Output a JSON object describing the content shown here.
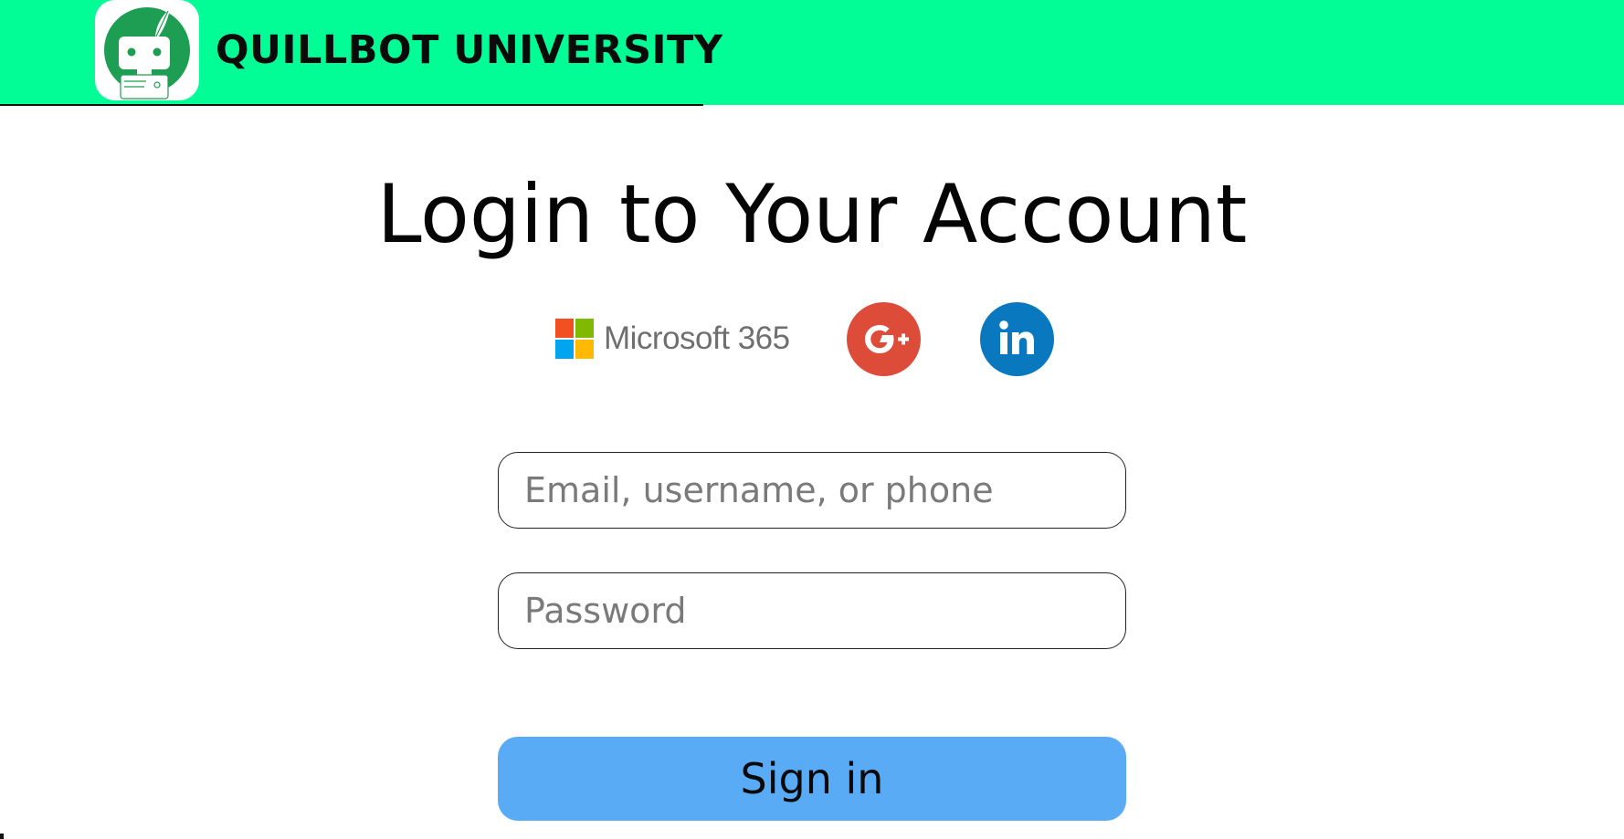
{
  "header": {
    "brand": "QUILLBOT UNIVERSITY",
    "logo_icon": "quillbot-robot-icon",
    "background_color": "#02FD96"
  },
  "main": {
    "title": "Login to Your Account"
  },
  "social_logins": {
    "microsoft": {
      "label": "Microsoft 365",
      "icon": "microsoft-logo-icon"
    },
    "google_plus": {
      "label": "G+",
      "icon": "google-plus-icon",
      "color": "#DD4B39"
    },
    "linkedin": {
      "label": "in",
      "icon": "linkedin-icon",
      "color": "#0A78BE"
    }
  },
  "form": {
    "email_placeholder": "Email, username, or phone",
    "email_value": "",
    "password_placeholder": "Password",
    "password_value": "",
    "submit_label": "Sign in",
    "submit_color": "#5AABF5"
  }
}
